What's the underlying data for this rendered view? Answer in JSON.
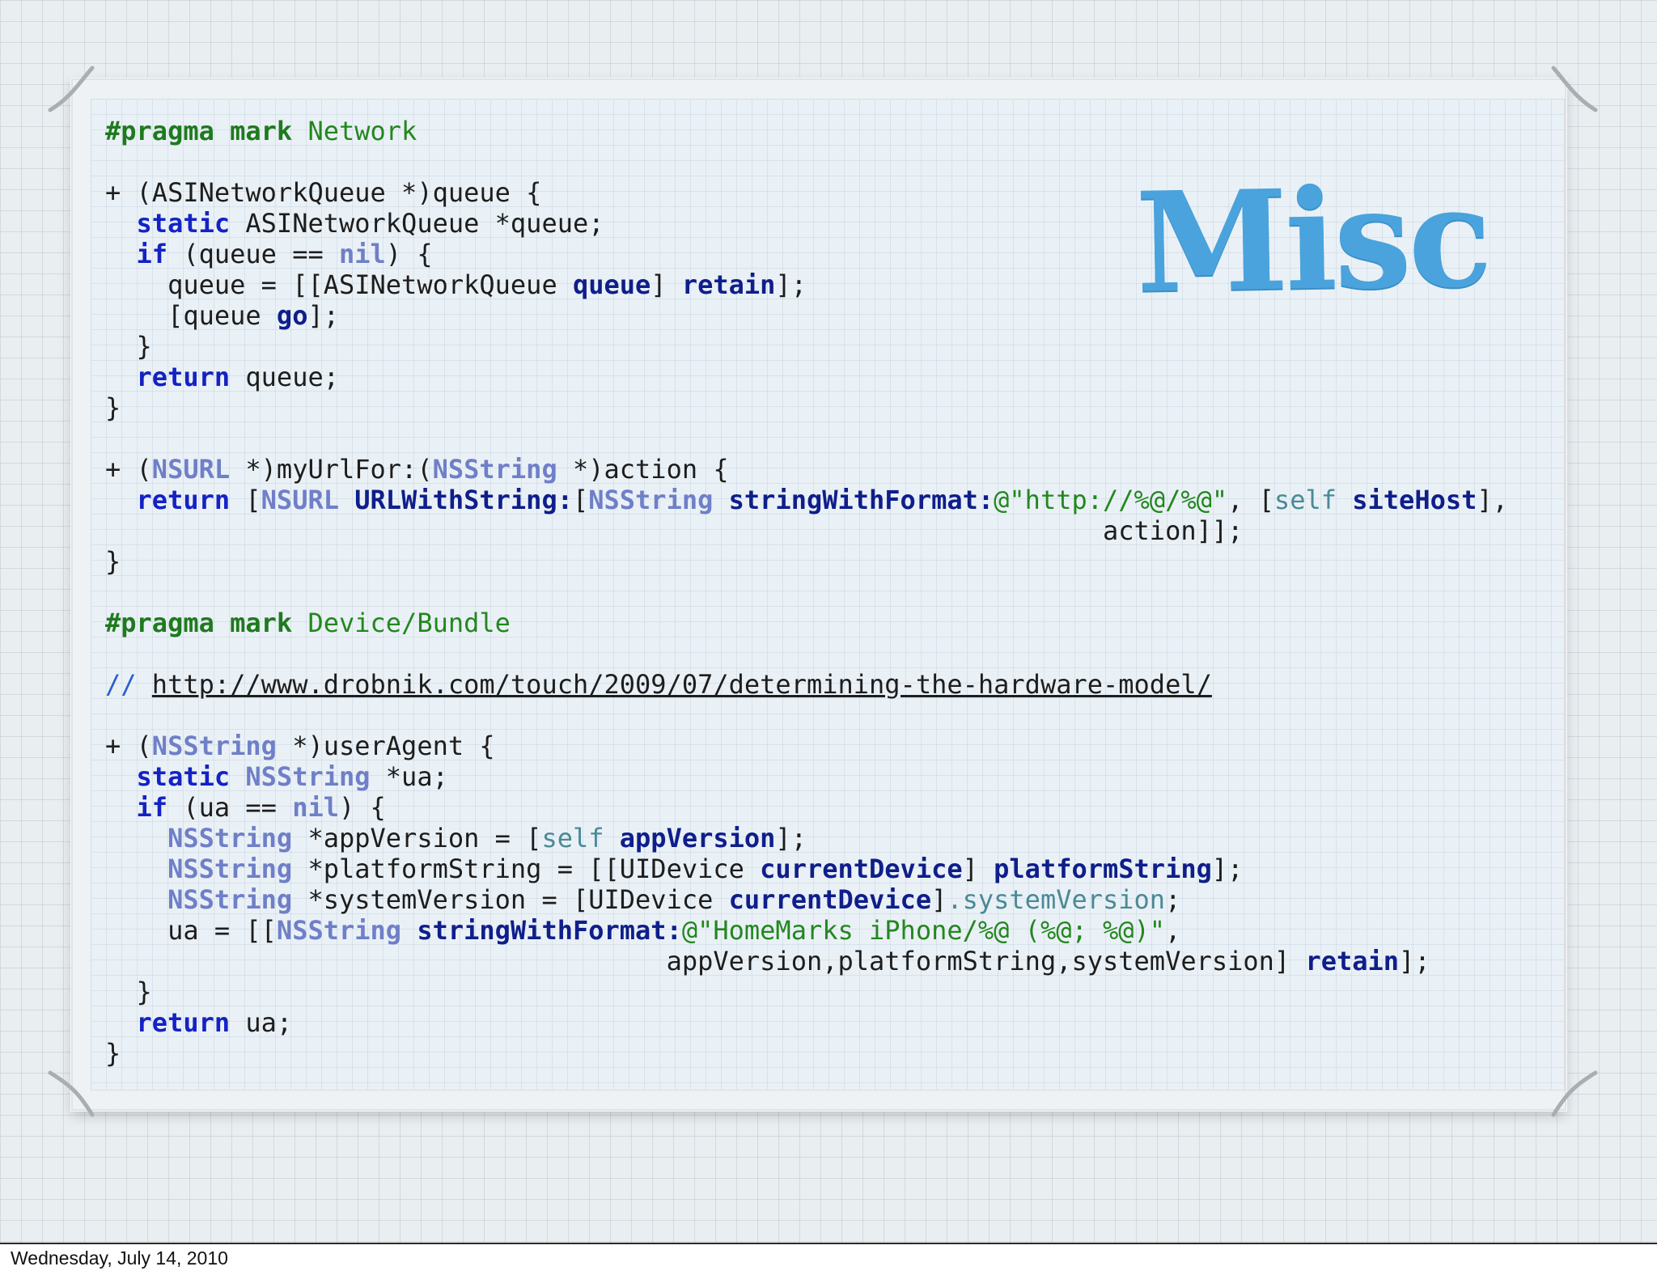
{
  "slide": {
    "title": "Misc",
    "colors": {
      "title": "#4aa3dc",
      "keyword": "#1422c4",
      "class": "#6f7fc8",
      "string": "#23871f"
    }
  },
  "code": {
    "pragma_kw": "#pragma mark",
    "pragma_network": "Network",
    "pragma_device": "Device/Bundle",
    "comment_prefix": "//",
    "comment_url": "http://www.drobnik.com/touch/2009/07/determining-the-hardware-model/",
    "kw_static": "static",
    "kw_if": "if",
    "kw_return": "return",
    "kw_nil": "nil",
    "kw_self": "self",
    "c_nsurl": "NSURL",
    "c_nsstring": "NSString",
    "m_queue": "queue",
    "m_retain": "retain",
    "m_go": "go",
    "m_urlwithstring": "URLWithString:",
    "m_stringwithformat": "stringWithFormat:",
    "m_sitehost": "siteHost",
    "m_appversion": "appVersion",
    "m_currentdevice": "currentDevice",
    "m_platformstring": "platformString",
    "p_systemversion": ".systemVersion",
    "s_http": "@\"http://%@/%@\"",
    "s_homemarks": "@\"HomeMarks iPhone/%@ (%@; %@)\"",
    "t_queue_sig": "+ (ASINetworkQueue *)queue {",
    "t_queue_decl": " ASINetworkQueue *queue;",
    "t_queue_if": " (queue == ",
    "t_queue_assign": "    queue = [[ASINetworkQueue ",
    "t_queue_go": "    [queue ",
    "t_close_inner": "  }",
    "t_return_queue": " queue;",
    "t_close": "}",
    "t_myurl_a": "+ (",
    "t_myurl_b": " *)myUrlFor:(",
    "t_myurl_c": " *)action {",
    "t_action_cont": "                                                                action]];",
    "t_ua_b": " *)userAgent {",
    "t_ua_decl": " *ua;",
    "t_ua_if": " (ua == ",
    "t_appversion_decl": " *appVersion = [",
    "t_platform_decl": " *platformString = [[UIDevice ",
    "t_system_decl": " *systemVersion = [UIDevice ",
    "t_ua_assign": "    ua = [[",
    "t_ua_cont": "                                    appVersion,platformString,systemVersion] ",
    "t_return_ua": " ua;"
  },
  "footer": {
    "date": "Wednesday, July 14, 2010"
  }
}
